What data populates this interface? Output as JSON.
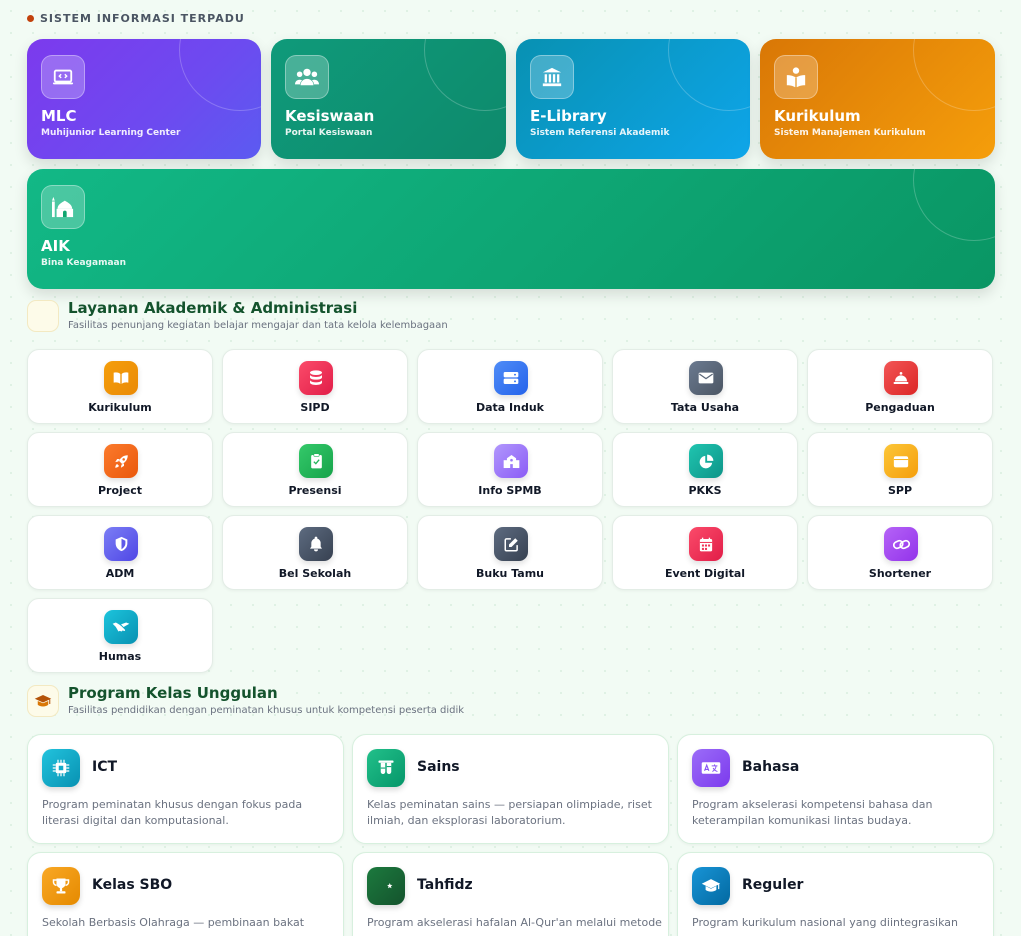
{
  "section_label": "SISTEM INFORMASI TERPADU",
  "heroes": [
    {
      "title": "MLC",
      "subtitle": "Muhijunior Learning Center",
      "icon": "laptop-code-icon"
    },
    {
      "title": "Kesiswaan",
      "subtitle": "Portal Kesiswaan",
      "icon": "users-icon"
    },
    {
      "title": "E-Library",
      "subtitle": "Sistem Referensi Akademik",
      "icon": "library-building-icon"
    },
    {
      "title": "Kurikulum",
      "subtitle": "Sistem Manajemen Kurikulum",
      "icon": "book-reader-icon"
    },
    {
      "title": "AIK",
      "subtitle": "Bina Keagamaan",
      "icon": "mosque-icon"
    }
  ],
  "layanan": {
    "title": "Layanan Akademik & Administrasi",
    "subtitle": "Fasilitas penunjang kegiatan belajar mengajar dan tata kelola kelembagaan",
    "items": [
      {
        "label": "Kurikulum",
        "icon": "book-open-icon",
        "color": "#f59e0b"
      },
      {
        "label": "SIPD",
        "icon": "database-icon",
        "color": "#f43f5e"
      },
      {
        "label": "Data Induk",
        "icon": "server-icon",
        "color": "#3b82f6"
      },
      {
        "label": "Tata Usaha",
        "icon": "envelope-icon",
        "color": "#64748b"
      },
      {
        "label": "Pengaduan",
        "icon": "bell-concierge-icon",
        "color": "#ef4444"
      },
      {
        "label": "Project",
        "icon": "rocket-icon",
        "color": "#f97316"
      },
      {
        "label": "Presensi",
        "icon": "clipboard-check-icon",
        "color": "#22c55e"
      },
      {
        "label": "Info SPMB",
        "icon": "school-icon",
        "color": "#a78bfa"
      },
      {
        "label": "PKKS",
        "icon": "chart-pie-icon",
        "color": "#14b8a6"
      },
      {
        "label": "SPP",
        "icon": "wallet-icon",
        "color": "#fbbf24"
      },
      {
        "label": "ADM",
        "icon": "shield-icon",
        "color": "#6366f1"
      },
      {
        "label": "Bel Sekolah",
        "icon": "bell-icon",
        "color": "#475569"
      },
      {
        "label": "Buku Tamu",
        "icon": "edit-icon",
        "color": "#475569"
      },
      {
        "label": "Event Digital",
        "icon": "calendar-icon",
        "color": "#f43f5e"
      },
      {
        "label": "Shortener",
        "icon": "link-icon",
        "color": "#a855f7"
      },
      {
        "label": "Humas",
        "icon": "handshake-icon",
        "color": "#06b6d4"
      }
    ]
  },
  "program": {
    "title": "Program Kelas Unggulan",
    "subtitle": "Fasilitas pendidikan dengan peminatan khusus untuk kompetensi peserta didik",
    "items": [
      {
        "title": "ICT",
        "icon": "microchip-icon",
        "color": "#06b6d4",
        "desc": "Program peminatan khusus dengan fokus pada literasi digital dan komputasional."
      },
      {
        "title": "Sains",
        "icon": "flask-icon",
        "color": "#10b981",
        "desc": "Kelas peminatan sains — persiapan olimpiade, riset ilmiah, dan eksplorasi laboratorium."
      },
      {
        "title": "Bahasa",
        "icon": "language-icon",
        "color": "#8b5cf6",
        "desc": "Program akselerasi kompetensi bahasa dan keterampilan komunikasi lintas budaya."
      },
      {
        "title": "Kelas SBO",
        "icon": "trophy-icon",
        "color": "#f59e0b",
        "desc": "Sekolah Berbasis Olahraga — pembinaan bakat"
      },
      {
        "title": "Tahfidz",
        "icon": "star-crescent-icon",
        "color": "#166534",
        "desc": "Program akselerasi hafalan Al-Qur'an melalui metode"
      },
      {
        "title": "Reguler",
        "icon": "graduation-cap-icon",
        "color": "#0284c7",
        "desc": "Program kurikulum nasional yang diintegrasikan"
      }
    ]
  }
}
